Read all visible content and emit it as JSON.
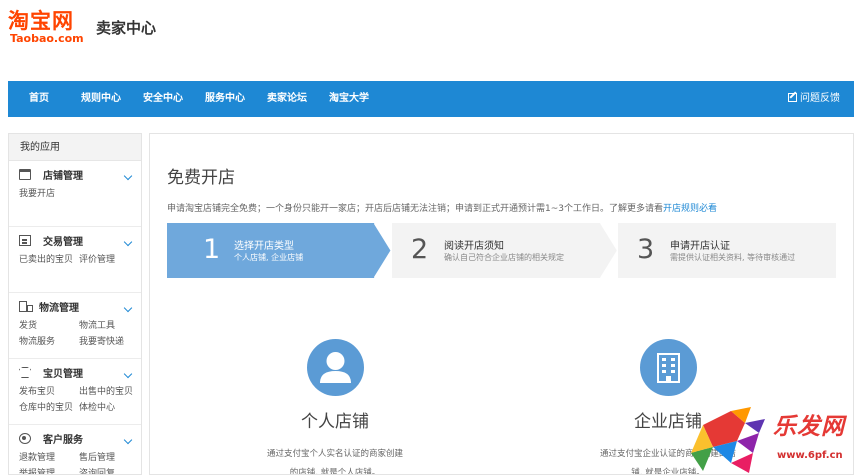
{
  "header": {
    "logo_cn": "淘宝网",
    "logo_en": "Taobao.com",
    "site_title": "卖家中心"
  },
  "nav": {
    "items": [
      "首页",
      "规则中心",
      "安全中心",
      "服务中心",
      "卖家论坛",
      "淘宝大学"
    ],
    "feedback_label": "问题反馈"
  },
  "sidebar": {
    "heading": "我的应用",
    "groups": [
      {
        "title": "店铺管理",
        "icon": "shop-icon",
        "links": [
          "我要开店"
        ]
      },
      {
        "title": "交易管理",
        "icon": "trade-icon",
        "links": [
          "已卖出的宝贝",
          "评价管理"
        ]
      },
      {
        "title": "物流管理",
        "icon": "truck-icon",
        "links": [
          "发货",
          "物流工具",
          "物流服务",
          "我要寄快递"
        ]
      },
      {
        "title": "宝贝管理",
        "icon": "shirt-icon",
        "links": [
          "发布宝贝",
          "出售中的宝贝",
          "仓库中的宝贝",
          "体检中心"
        ]
      },
      {
        "title": "客户服务",
        "icon": "user-icon",
        "links": [
          "退款管理",
          "售后管理",
          "举报管理",
          "咨询回复"
        ]
      }
    ]
  },
  "main": {
    "title": "免费开店",
    "intro": "申请淘宝店铺完全免费；一个身份只能开一家店；开店后店铺无法注销；申请到正式开通预计需1~3个工作日。了解更多请看",
    "intro_link": "开店规则必看",
    "steps": [
      {
        "num": "1",
        "title": "选择开店类型",
        "sub": "个人店铺, 企业店铺",
        "active": true
      },
      {
        "num": "2",
        "title": "阅读开店须知",
        "sub": "确认自己符合企业店铺的相关规定",
        "active": false
      },
      {
        "num": "3",
        "title": "申请开店认证",
        "sub": "需提供认证相关资料, 等待审核通过",
        "active": false
      }
    ],
    "cards": [
      {
        "name": "个人店铺",
        "desc1": "通过支付宝个人实名认证的商家创建",
        "desc2": "的店铺, 就是个人店铺。",
        "icon": "person-icon"
      },
      {
        "name": "企业店铺",
        "desc1": "通过支付宝企业认证的商家创建的店",
        "desc2": "铺, 就是企业店铺。",
        "icon": "building-icon"
      }
    ]
  },
  "watermark": {
    "text": "乐发网",
    "url": "www.6pf.cn"
  },
  "colors": {
    "accent": "#1e88d4",
    "brand": "#ff4400",
    "step_active": "#6fa8dc",
    "icon_circle": "#5b9bd5"
  }
}
